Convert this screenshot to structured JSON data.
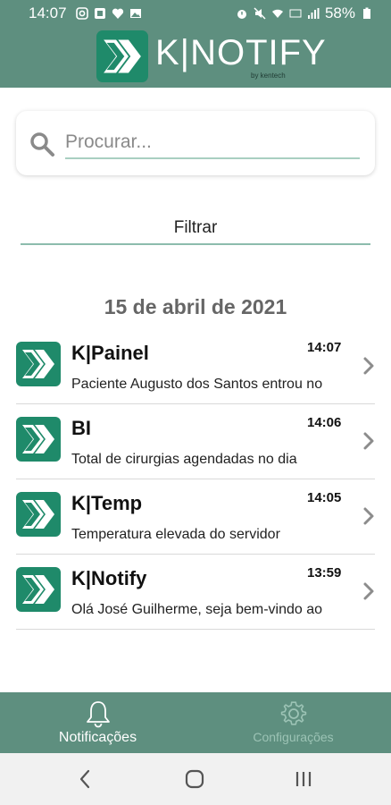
{
  "status_bar": {
    "time": "14:07",
    "battery": "58%",
    "left_icons": [
      "instagram-icon",
      "app-icon",
      "heart-icon",
      "image-icon"
    ],
    "right_icons": [
      "alarm-icon",
      "mute-icon",
      "wifi-icon",
      "volte-icon",
      "signal-icon",
      "battery-icon"
    ]
  },
  "header": {
    "logo_text": "K|NOTIFY",
    "logo_sub": "by kentech",
    "brand_color": "#5e8f7f",
    "accent_color": "#1f8a6a"
  },
  "search": {
    "placeholder": "Procurar...",
    "value": ""
  },
  "filter": {
    "label": "Filtrar"
  },
  "list": {
    "date": "15 de abril de 2021",
    "items": [
      {
        "title": "K|Painel",
        "time": "14:07",
        "body": "Paciente Augusto dos Santos entrou no"
      },
      {
        "title": "BI",
        "time": "14:06",
        "body": "Total de cirurgias agendadas no dia"
      },
      {
        "title": "K|Temp",
        "time": "14:05",
        "body": "Temperatura elevada do servidor"
      },
      {
        "title": "K|Notify",
        "time": "13:59",
        "body": "Olá José Guilherme, seja bem-vindo ao"
      }
    ]
  },
  "bottom_nav": {
    "tabs": [
      {
        "label": "Notificações",
        "icon": "bell-icon",
        "active": true
      },
      {
        "label": "Configurações",
        "icon": "gear-icon",
        "active": false
      }
    ]
  },
  "system_nav": {
    "buttons": [
      "back-icon",
      "home-icon",
      "recents-icon"
    ]
  }
}
